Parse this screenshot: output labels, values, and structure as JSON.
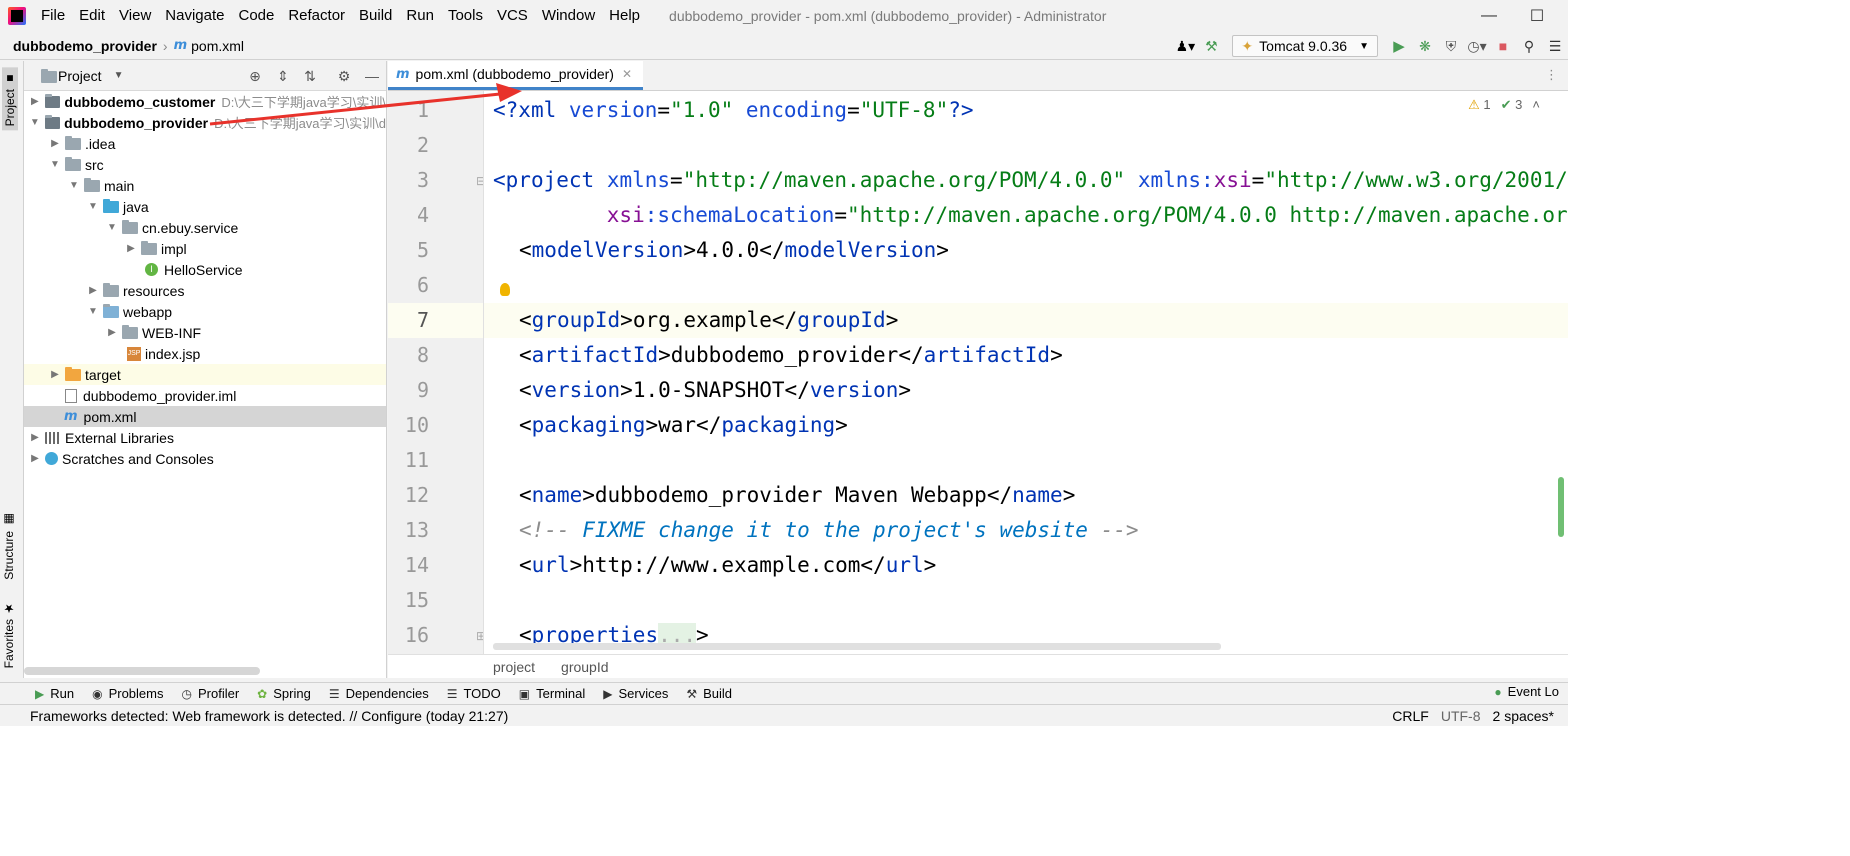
{
  "menu": [
    "File",
    "Edit",
    "View",
    "Navigate",
    "Code",
    "Refactor",
    "Build",
    "Run",
    "Tools",
    "VCS",
    "Window",
    "Help"
  ],
  "window_title": "dubbodemo_provider - pom.xml (dubbodemo_provider) - Administrator",
  "navbar": {
    "project": "dubbodemo_provider",
    "file_icon": "m",
    "file": "pom.xml"
  },
  "run_config": "Tomcat 9.0.36",
  "side_tabs": {
    "project": "Project",
    "structure": "Structure",
    "favorites": "Favorites"
  },
  "project_panel": {
    "title": "Project"
  },
  "tree": [
    {
      "label": "dubbodemo_customer",
      "path": "D:\\大三下学期java学习\\实训\\",
      "bold": true
    },
    {
      "label": "dubbodemo_provider",
      "path": "D:\\大三下学期java学习\\实训\\d",
      "bold": true
    },
    {
      "label": ".idea"
    },
    {
      "label": "src"
    },
    {
      "label": "main"
    },
    {
      "label": "java"
    },
    {
      "label": "cn.ebuy.service"
    },
    {
      "label": "impl"
    },
    {
      "label": "HelloService"
    },
    {
      "label": "resources"
    },
    {
      "label": "webapp"
    },
    {
      "label": "WEB-INF"
    },
    {
      "label": "index.jsp"
    },
    {
      "label": "target"
    },
    {
      "label": "dubbodemo_provider.iml"
    },
    {
      "label": "pom.xml"
    },
    {
      "label": "External Libraries"
    },
    {
      "label": "Scratches and Consoles"
    }
  ],
  "editor": {
    "tab_label": "pom.xml (dubbodemo_provider)",
    "line_numbers": [
      "1",
      "2",
      "3",
      "4",
      "5",
      "6",
      "7",
      "8",
      "9",
      "10",
      "11",
      "12",
      "13",
      "14",
      "15",
      "16"
    ],
    "inspections": {
      "warnings": "1",
      "checks": "3"
    },
    "breadcrumb": [
      "project",
      "groupId"
    ],
    "lines": {
      "l1_a": "<?",
      "l1_b": "xml ",
      "l1_c": "version",
      "l1_d": "=",
      "l1_e": "\"1.0\"",
      "l1_f": " encoding",
      "l1_g": "=",
      "l1_h": "\"UTF-8\"",
      "l1_i": "?>",
      "l3_a": "<",
      "l3_b": "project ",
      "l3_c": "xmlns",
      "l3_d": "=",
      "l3_e": "\"http://maven.apache.org/POM/4.0.0\"",
      "l3_f": " xmlns:",
      "l3_g": "xsi",
      "l3_h": "=",
      "l3_i": "\"http://www.w3.org/2001/",
      "l4_a": "         xsi",
      "l4_b": ":schemaLocation",
      "l4_c": "=",
      "l4_d": "\"http://maven.apache.org/POM/4.0.0 http://maven.apache.or",
      "l5_open": "modelVersion",
      "l5_val": "4.0.0",
      "l7_open": "groupId",
      "l7_val": "org.example",
      "l8_open": "artifactId",
      "l8_val": "dubbodemo_provider",
      "l9_open": "version",
      "l9_val": "1.0-SNAPSHOT",
      "l10_open": "packaging",
      "l10_val": "war",
      "l12_open": "name",
      "l12_val": "dubbodemo_provider Maven Webapp",
      "l13_a": "<!-- ",
      "l13_b": "FIXME change it to the project's website",
      "l13_c": " -->",
      "l14_open": "url",
      "l14_val": "http://www.example.com",
      "l16_open": "properties",
      "l16_fold": "..."
    }
  },
  "bottom_tools": [
    {
      "icon": "run-icon",
      "label": "Run"
    },
    {
      "icon": "problems-icon",
      "label": "Problems"
    },
    {
      "icon": "profiler-icon",
      "label": "Profiler"
    },
    {
      "icon": "spring-icon",
      "label": "Spring"
    },
    {
      "icon": "dependencies-icon",
      "label": "Dependencies"
    },
    {
      "icon": "todo-icon",
      "label": "TODO"
    },
    {
      "icon": "terminal-icon",
      "label": "Terminal"
    },
    {
      "icon": "services-icon",
      "label": "Services"
    },
    {
      "icon": "build-icon",
      "label": "Build"
    }
  ],
  "event_log": "Event Lo",
  "status": {
    "message": "Frameworks detected: Web framework is detected. // Configure (today 21:27)",
    "line_sep": "CRLF",
    "encoding": "UTF-8",
    "indent": "2 spaces*"
  },
  "colors": {
    "accent": "#4083c9",
    "tag": "#0033b3",
    "value": "#067d17",
    "annotation_arrow": "#e8322b"
  }
}
